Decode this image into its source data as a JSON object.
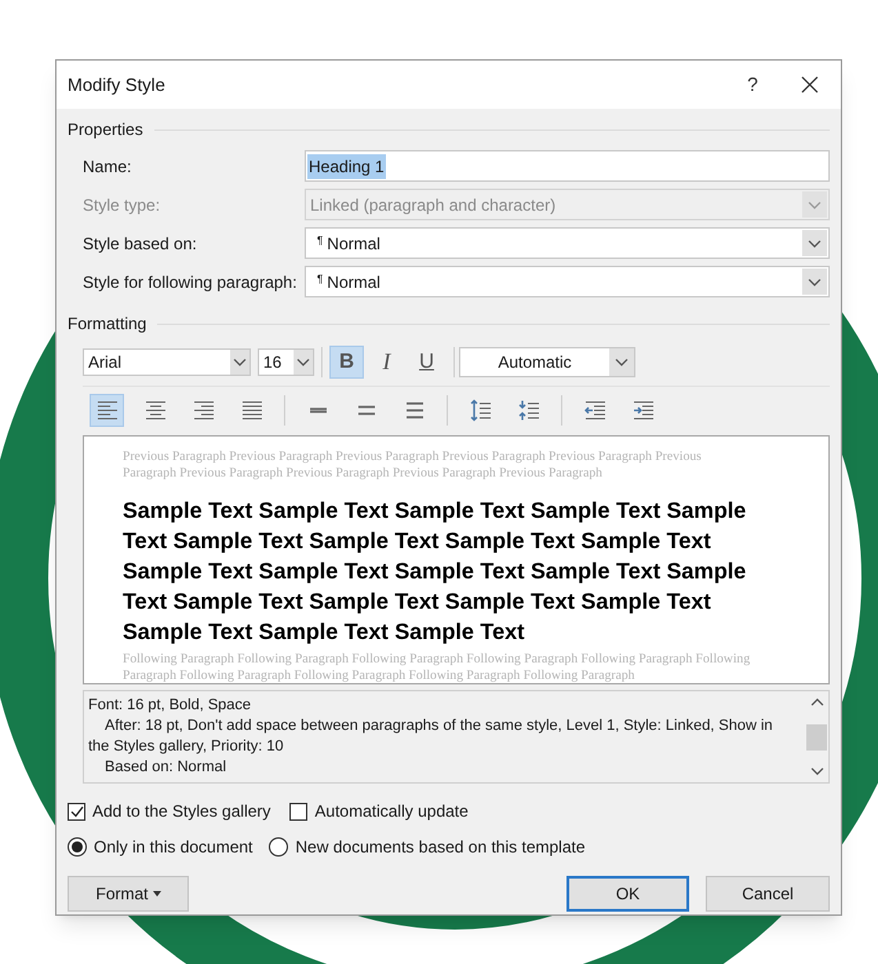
{
  "dialog": {
    "title": "Modify Style",
    "help": "?"
  },
  "properties": {
    "heading": "Properties",
    "fields": [
      {
        "label": "Name:",
        "value": "Heading 1",
        "kind": "text",
        "disabled": false,
        "text_selected": true
      },
      {
        "label": "Style type:",
        "value": "Linked (paragraph and character)",
        "kind": "dropdown",
        "disabled": true
      },
      {
        "label": "Style based on:",
        "value": "Normal",
        "kind": "dropdown",
        "disabled": false,
        "pilcrow": "¶"
      },
      {
        "label": "Style for following paragraph:",
        "value": "Normal",
        "kind": "dropdown",
        "disabled": false,
        "pilcrow": "¶"
      }
    ]
  },
  "formatting": {
    "heading": "Formatting",
    "font": "Arial",
    "size": "16",
    "style_buttons": [
      {
        "kind": "bold",
        "label": "B",
        "selected": true
      },
      {
        "kind": "italic",
        "label": "I",
        "selected": false
      },
      {
        "kind": "underline",
        "label": "U",
        "selected": false
      }
    ],
    "text_color": "Automatic",
    "paragraph_groups": [
      [
        {
          "kind": "align-left",
          "selected": true
        },
        {
          "kind": "align-center",
          "selected": false
        },
        {
          "kind": "align-right",
          "selected": false
        },
        {
          "kind": "justify",
          "selected": false
        }
      ],
      [
        {
          "kind": "single-spacing",
          "selected": false
        },
        {
          "kind": "one-half-spacing",
          "selected": false
        },
        {
          "kind": "double-spacing",
          "selected": false
        }
      ],
      [
        {
          "kind": "increase-spacing",
          "selected": false
        },
        {
          "kind": "decrease-spacing",
          "selected": false
        }
      ],
      [
        {
          "kind": "decrease-indent",
          "selected": false
        },
        {
          "kind": "increase-indent",
          "selected": false
        }
      ]
    ]
  },
  "preview": {
    "previous": "Previous Paragraph Previous Paragraph Previous Paragraph Previous Paragraph Previous Paragraph Previous Paragraph Previous Paragraph Previous Paragraph Previous Paragraph Previous Paragraph",
    "sample": "Sample Text Sample Text Sample Text Sample Text Sample Text Sample Text Sample Text Sample Text Sample Text Sample Text Sample Text Sample Text Sample Text Sample Text Sample Text Sample Text Sample Text Sample Text Sample Text Sample Text Sample Text",
    "following": "Following Paragraph Following Paragraph Following Paragraph Following Paragraph Following Paragraph Following Paragraph Following Paragraph Following Paragraph Following Paragraph Following Paragraph"
  },
  "description": {
    "lines": [
      "Font: 16 pt, Bold, Space",
      "After:  18 pt, Don't add space between paragraphs of the same style, Level 1, Style: Linked, Show in the Styles gallery, Priority: 10",
      "Based on: Normal"
    ]
  },
  "checkboxes": [
    {
      "label": "Add to the Styles gallery",
      "checked": true
    },
    {
      "label": "Automatically update",
      "checked": false
    }
  ],
  "radios": [
    {
      "label": "Only in this document",
      "selected": true
    },
    {
      "label": "New documents based on this template",
      "selected": false
    }
  ],
  "buttons": {
    "format": "Format",
    "ok": "OK",
    "cancel": "Cancel"
  }
}
